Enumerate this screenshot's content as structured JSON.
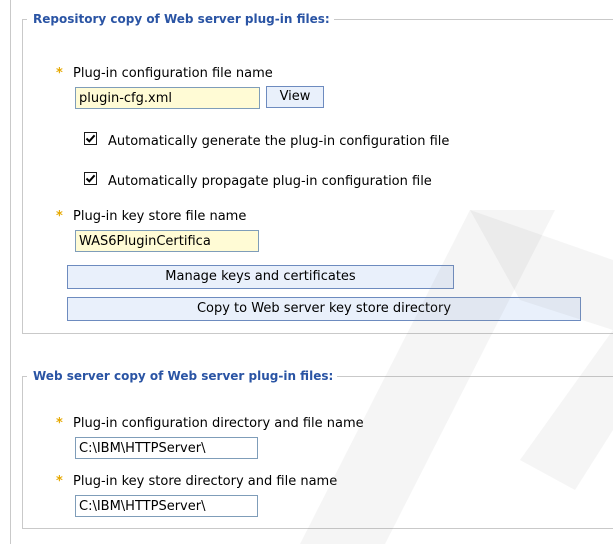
{
  "repository_section": {
    "legend": "Repository copy of Web server plug-in files:",
    "config_file": {
      "label": "Plug-in configuration file name",
      "value": "plugin-cfg.xml",
      "view_button": "View"
    },
    "auto_generate": {
      "label": "Automatically generate the plug-in configuration file",
      "checked": true
    },
    "auto_propagate": {
      "label": "Automatically propagate plug-in configuration file",
      "checked": true
    },
    "keystore_file": {
      "label": "Plug-in key store file name",
      "value": "WAS6PluginCertifica"
    },
    "manage_keys_button": "Manage keys and certificates",
    "copy_keystore_button": "Copy to Web server key store directory"
  },
  "webserver_section": {
    "legend": "Web server copy of Web server plug-in files:",
    "config_dir": {
      "label": "Plug-in configuration directory and file name",
      "value": "C:\\IBM\\HTTPServer\\"
    },
    "keystore_dir": {
      "label": "Plug-in key store directory and file name",
      "value": "C:\\IBM\\HTTPServer\\"
    }
  },
  "required_marker": "*",
  "colors": {
    "legend_text": "#2a54a4",
    "required_star": "#e6a800",
    "required_field_bg": "#fffbd5",
    "button_bg": "#e9f0fb",
    "button_border": "#6d8bbf",
    "field_border": "#7f9db9",
    "section_border": "#c9c9c9"
  }
}
